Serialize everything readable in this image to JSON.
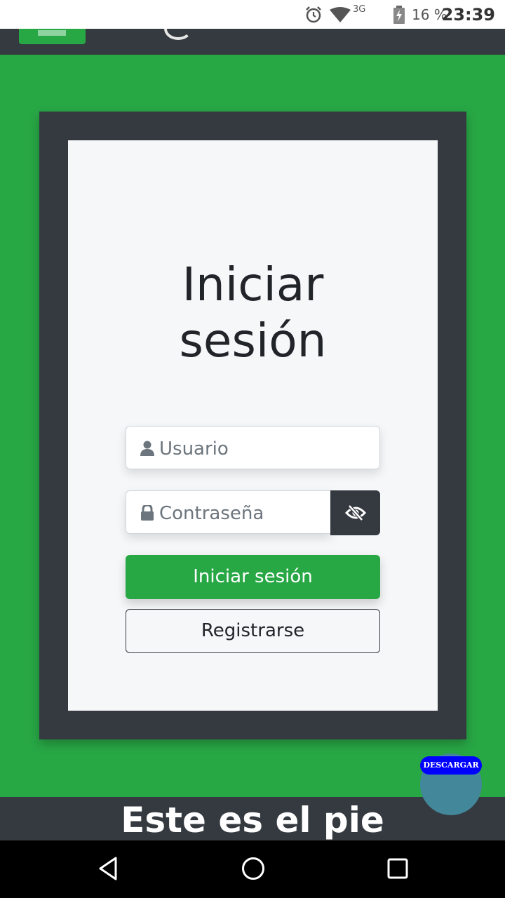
{
  "status_bar": {
    "network": "3G",
    "battery": "16 %",
    "time": "23:39",
    "icons": [
      "alarm-icon",
      "wifi-icon",
      "battery-icon"
    ]
  },
  "login": {
    "title_line1": "Iniciar",
    "title_line2": "sesión",
    "username_placeholder": "Usuario",
    "password_placeholder": "Contraseña",
    "login_button": "Iniciar sesión",
    "register_button": "Registrarse"
  },
  "footer": {
    "text": "Este es el pie"
  },
  "download_button": {
    "label": "DESCARGAR"
  },
  "colors": {
    "brand_green": "#28a745",
    "dark": "#343a40",
    "card": "#f6f7f9",
    "fab": "#43879a",
    "fab_label": "#0000ff"
  },
  "system_nav": [
    "back-icon",
    "home-icon",
    "recents-icon"
  ]
}
